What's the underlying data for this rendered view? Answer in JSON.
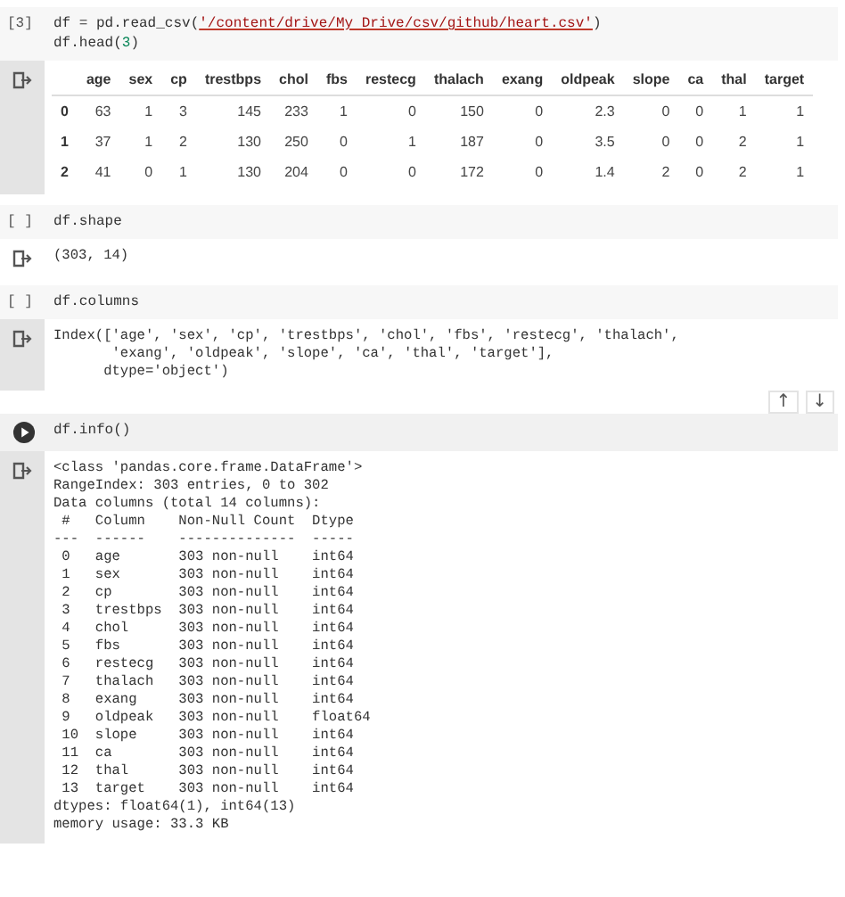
{
  "cells": [
    {
      "prompt": {
        "kind": "count",
        "text": "[3]"
      },
      "code": [
        [
          {
            "kind": "plain",
            "text": "df = pd.read_csv("
          },
          {
            "kind": "string",
            "text": "'/content/drive/My Drive/csv/github/heart.csv'"
          },
          {
            "kind": "plain",
            "text": ")"
          }
        ],
        [
          {
            "kind": "plain",
            "text": "df.head("
          },
          {
            "kind": "number",
            "text": "3"
          },
          {
            "kind": "plain",
            "text": ")"
          }
        ]
      ],
      "output": {
        "kind": "table",
        "left_bar": true,
        "columns": [
          "age",
          "sex",
          "cp",
          "trestbps",
          "chol",
          "fbs",
          "restecg",
          "thalach",
          "exang",
          "oldpeak",
          "slope",
          "ca",
          "thal",
          "target"
        ],
        "rows": [
          {
            "index": "0",
            "values": [
              "63",
              "1",
              "3",
              "145",
              "233",
              "1",
              "0",
              "150",
              "0",
              "2.3",
              "0",
              "0",
              "1",
              "1"
            ]
          },
          {
            "index": "1",
            "values": [
              "37",
              "1",
              "2",
              "130",
              "250",
              "0",
              "1",
              "187",
              "0",
              "3.5",
              "0",
              "0",
              "2",
              "1"
            ]
          },
          {
            "index": "2",
            "values": [
              "41",
              "0",
              "1",
              "130",
              "204",
              "0",
              "0",
              "172",
              "0",
              "1.4",
              "2",
              "0",
              "2",
              "1"
            ]
          }
        ]
      }
    },
    {
      "prompt": {
        "kind": "count",
        "text": "[ ]"
      },
      "code": [
        [
          {
            "kind": "plain",
            "text": "df.shape"
          }
        ]
      ],
      "output": {
        "kind": "text",
        "left_bar": false,
        "lines": [
          "(303, 14)"
        ]
      }
    },
    {
      "prompt": {
        "kind": "count",
        "text": "[ ]"
      },
      "code": [
        [
          {
            "kind": "plain",
            "text": "df.columns"
          }
        ]
      ],
      "output": {
        "kind": "text",
        "left_bar": true,
        "lines": [
          "Index(['age', 'sex', 'cp', 'trestbps', 'chol', 'fbs', 'restecg', 'thalach',",
          "       'exang', 'oldpeak', 'slope', 'ca', 'thal', 'target'],",
          "      dtype='object')"
        ]
      }
    },
    {
      "prompt": {
        "kind": "run"
      },
      "toolbar": [
        "↑",
        "↓"
      ],
      "code": [
        [
          {
            "kind": "plain",
            "text": "df.info()"
          }
        ]
      ],
      "output": {
        "kind": "text",
        "left_bar": true,
        "lines": [
          "<class 'pandas.core.frame.DataFrame'>",
          "RangeIndex: 303 entries, 0 to 302",
          "Data columns (total 14 columns):",
          " #   Column    Non-Null Count  Dtype  ",
          "---  ------    --------------  -----  ",
          " 0   age       303 non-null    int64  ",
          " 1   sex       303 non-null    int64  ",
          " 2   cp        303 non-null    int64  ",
          " 3   trestbps  303 non-null    int64  ",
          " 4   chol      303 non-null    int64  ",
          " 5   fbs       303 non-null    int64  ",
          " 6   restecg   303 non-null    int64  ",
          " 7   thalach   303 non-null    int64  ",
          " 8   exang     303 non-null    int64  ",
          " 9   oldpeak   303 non-null    float64",
          " 10  slope     303 non-null    int64  ",
          " 11  ca        303 non-null    int64  ",
          " 12  thal      303 non-null    int64  ",
          " 13  target    303 non-null    int64  ",
          "dtypes: float64(1), int64(13)",
          "memory usage: 33.3 KB"
        ]
      }
    }
  ]
}
